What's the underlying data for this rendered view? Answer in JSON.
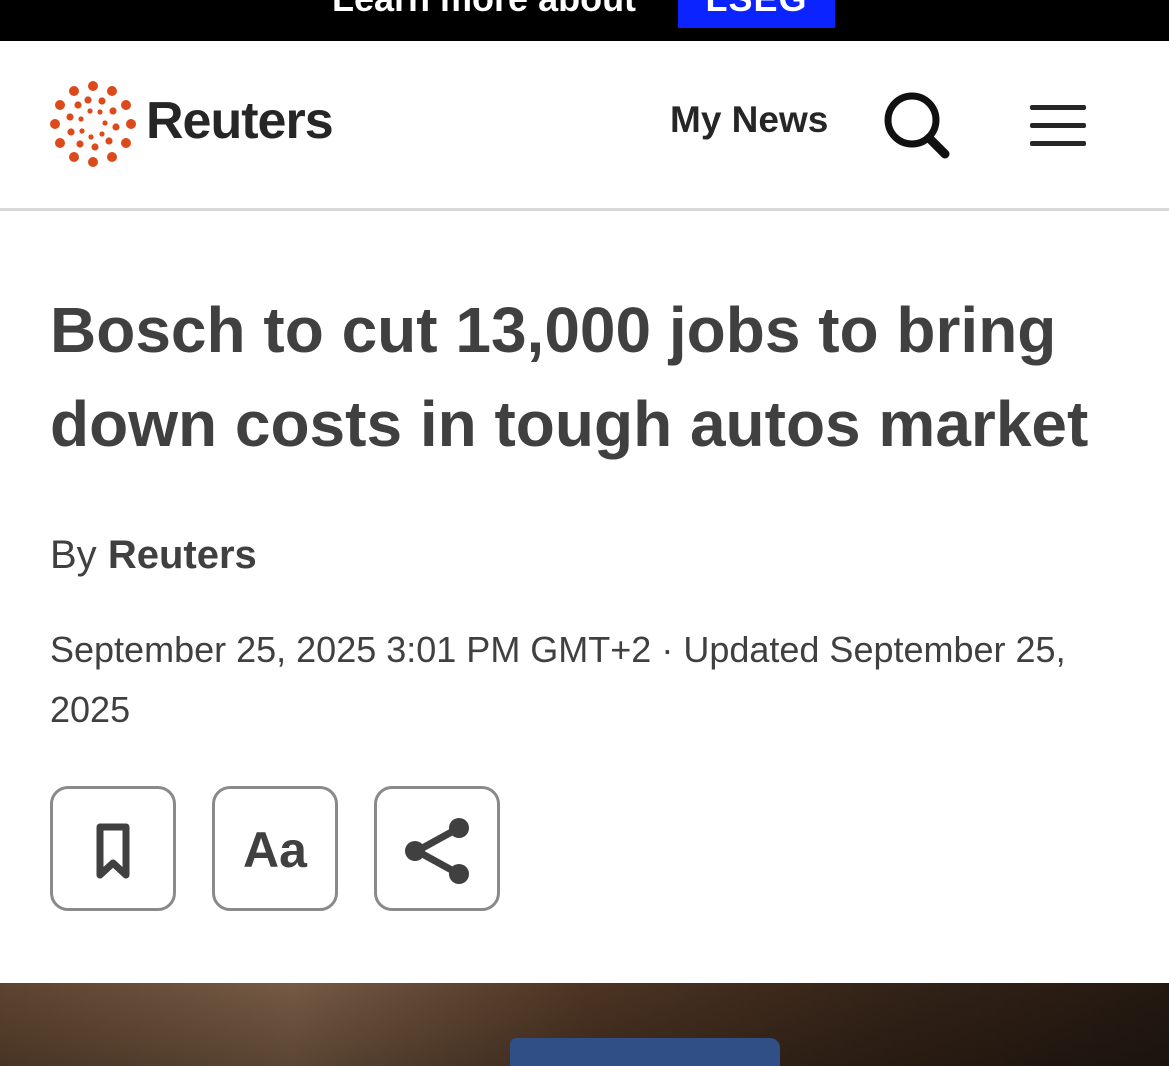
{
  "banner": {
    "text": "Learn more about",
    "badge": "LSEG"
  },
  "header": {
    "logo_text": "Reuters",
    "my_news_label": "My News",
    "search_icon": "search-icon",
    "menu_icon": "hamburger-menu-icon"
  },
  "article": {
    "headline": "Bosch to cut 13,000 jobs to bring down costs in tough autos market",
    "byline_prefix": "By",
    "author": "Reuters",
    "dateline": "September 25, 2025 3:01 PM GMT+2 · Updated September 25, 2025"
  },
  "toolbar": {
    "bookmark_icon": "bookmark-icon",
    "font_size_label": "Aa",
    "share_icon": "share-icon"
  },
  "colors": {
    "banner_bg": "#000000",
    "badge_bg": "#0a23ff",
    "logo_orange": "#dc4a1c",
    "text": "#404040"
  }
}
